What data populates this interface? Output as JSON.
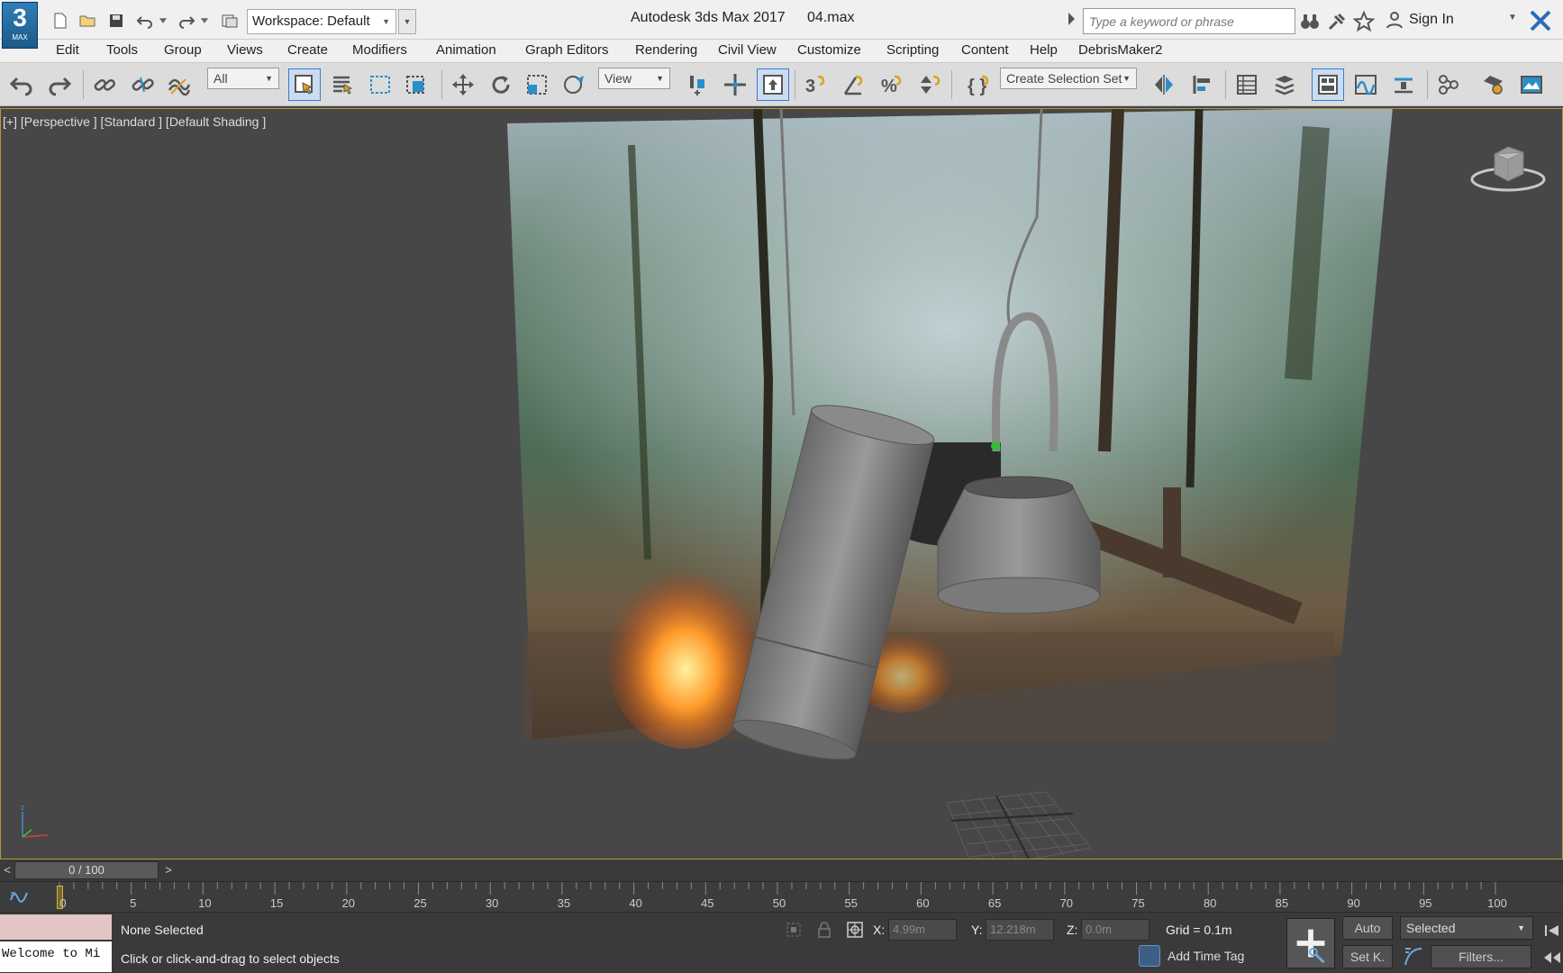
{
  "app": {
    "logo_main": "3",
    "logo_sub": "MAX",
    "title": "Autodesk 3ds Max 2017",
    "file": "04.max"
  },
  "workspace": {
    "label": "Workspace: Default"
  },
  "search": {
    "placeholder": "Type a keyword or phrase"
  },
  "account": {
    "sign_in": "Sign In"
  },
  "menu": [
    "Edit",
    "Tools",
    "Group",
    "Views",
    "Create",
    "Modifiers",
    "Animation",
    "Graph Editors",
    "Rendering",
    "Civil View",
    "Customize",
    "Scripting",
    "Content",
    "Help",
    "DebrisMaker2"
  ],
  "toolbar": {
    "selection_filter": "All",
    "reference_coord": "View",
    "named_selection": "Create Selection Set"
  },
  "viewport": {
    "label": "[+] [Perspective ] [Standard ] [Default Shading ]",
    "photo_watermark": "... "
  },
  "timeline": {
    "prev": "<",
    "next": ">",
    "frame_display": "0 / 100",
    "ticks": [
      0,
      5,
      10,
      15,
      20,
      25,
      30,
      35,
      40,
      45,
      50,
      55,
      60,
      65,
      70,
      75,
      80,
      85,
      90,
      95,
      100
    ],
    "current_frame": 0
  },
  "status": {
    "listener": "Welcome to Mi",
    "selection": "None Selected",
    "prompt": "Click or click-and-drag to select objects",
    "x_label": "X:",
    "x_value": "4.99m",
    "y_label": "Y:",
    "y_value": "12.218m",
    "z_label": "Z:",
    "z_value": "0.0m",
    "grid": "Grid = 0.1m",
    "add_time_tag": "Add Time Tag",
    "auto_key": "Auto",
    "set_key": "Set K.",
    "key_mode": "Selected",
    "filters": "Filters..."
  },
  "colors": {
    "viewport_bg": "#474747",
    "viewport_border": "#b59a3a",
    "active_tool": "#3b7bd1"
  }
}
